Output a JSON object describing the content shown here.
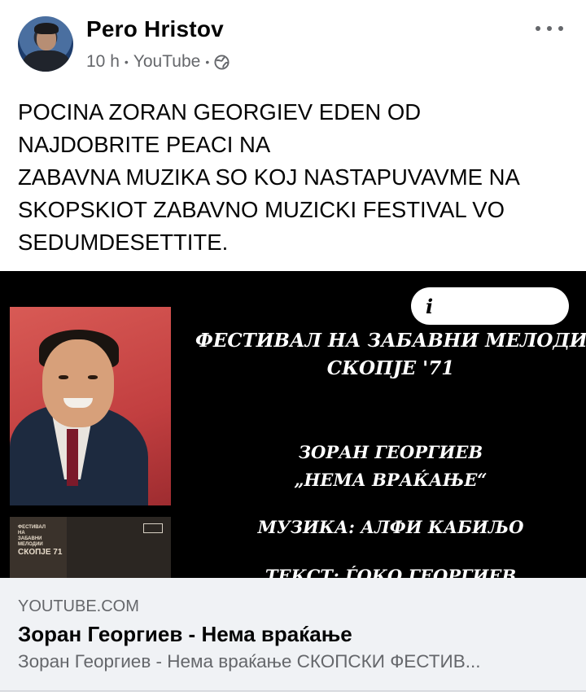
{
  "post": {
    "author": "Pero Hristov",
    "time": "10 h",
    "separator": "•",
    "source": "YouTube",
    "privacy_icon": "globe-icon",
    "more_icon": "more-options-icon",
    "text_lines": [
      "POCINA ZORAN GEORGIEV EDEN OD",
      "NAJDOBRITE PEACI NA",
      "ZABAVNA MUZIKA SO KOJ NASTAPUVAVME NA",
      "SKOPSKIOT ZABAVNO MUZICKI FESTIVAL VO",
      "SEDUMDESETTITE."
    ]
  },
  "video": {
    "info_icon_label": "i",
    "album_label": "ФЕСТИВАЛ\nНА\nЗАБАВНИ\nМЕЛОДИИ",
    "album_label2": "СКОПЈЕ 71",
    "lines": [
      "ФЕСТИВАЛ НА ЗАБАВНИ МЕЛОДИИ",
      "СКОПЈЕ '71",
      "ЗОРАН ГЕОРГИЕВ",
      "„НЕМА ВРАЌАЊЕ“",
      "МУЗИКА: АЛФИ КАБИЉО",
      "ТЕКСТ: ЃОКО ГЕОРГИЕВ"
    ]
  },
  "link": {
    "domain": "YOUTUBE.COM",
    "title": "Зоран Георгиев - Нема враќање",
    "description": "Зоран Георгиев - Нема враќање СКОПСКИ ФЕСТИВ..."
  },
  "colors": {
    "secondary_text": "#65676b",
    "link_bg": "#f0f2f5",
    "video_bg": "#000000"
  }
}
